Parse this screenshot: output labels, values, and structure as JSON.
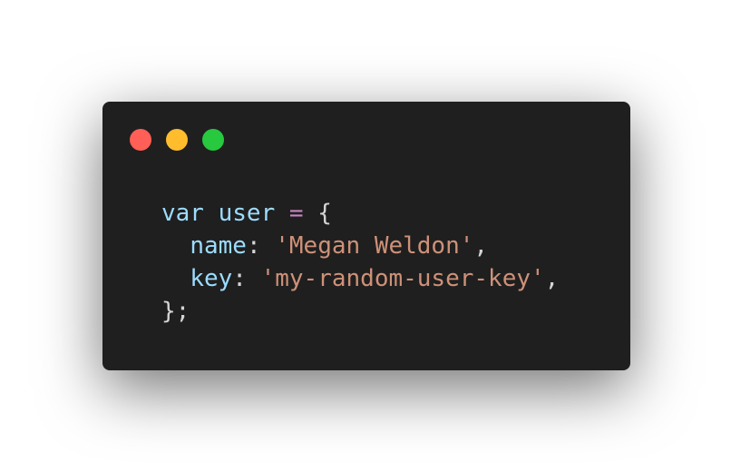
{
  "window": {
    "controls": {
      "close_color": "#ff5f56",
      "minimize_color": "#ffbd2e",
      "zoom_color": "#27c93f"
    }
  },
  "code": {
    "language": "javascript",
    "line1": {
      "keyword": "var",
      "identifier": "user",
      "operator": "=",
      "open_brace": "{"
    },
    "line2": {
      "property": "name",
      "colon": ":",
      "value": "'Megan Weldon'",
      "comma": ","
    },
    "line3": {
      "property": "key",
      "colon": ":",
      "value": "'my-random-user-key'",
      "comma": ","
    },
    "line4": {
      "close": "};"
    }
  }
}
